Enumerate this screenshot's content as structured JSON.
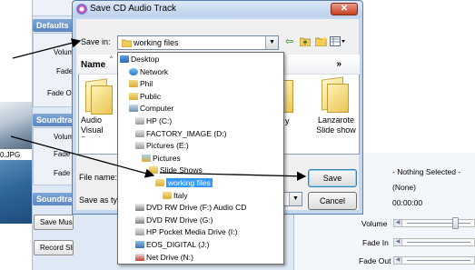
{
  "background": {
    "sections": [
      {
        "title": "Defaults",
        "labels": [
          "Volume",
          "Fade In",
          "Fade Out"
        ]
      },
      {
        "title": "Soundtrack",
        "labels": [
          "Volume",
          "Fade In",
          "Fade Out"
        ]
      },
      {
        "title": "Soundtrack"
      }
    ],
    "buttons": {
      "save_music": "Save Music From CD",
      "record_timings": "Record Slide Timings"
    },
    "photo_label": "0.JPG",
    "right_panel": {
      "nothing_selected": "- Nothing Selected -",
      "none": "(None)",
      "time": "00:00:00",
      "labels": [
        "Volume",
        "Fade In",
        "Fade Out"
      ]
    }
  },
  "dialog": {
    "title": "Save CD Audio Track",
    "save_in_label": "Save in:",
    "save_in_value": "working files",
    "name_column": "Name",
    "folders": [
      {
        "name": "Audio Visual Road Show"
      },
      {
        "name": "Lanzarote Slide show"
      }
    ],
    "folder_partial_text": "y",
    "file_name_label": "File name:",
    "save_as_type_label": "Save as type:",
    "save_button": "Save",
    "cancel_button": "Cancel"
  },
  "dropdown_items": [
    {
      "label": "Desktop",
      "icon": "desktop-icon",
      "selected": false
    },
    {
      "label": "Network",
      "icon": "network-icon",
      "selected": false
    },
    {
      "label": "Phil",
      "icon": "user-folder-icon",
      "selected": false
    },
    {
      "label": "Public",
      "icon": "folder-icon",
      "selected": false
    },
    {
      "label": "Computer",
      "icon": "computer-icon",
      "selected": false
    },
    {
      "label": "HP (C:)",
      "icon": "drive-icon",
      "selected": false
    },
    {
      "label": "FACTORY_IMAGE (D:)",
      "icon": "drive-icon",
      "selected": false
    },
    {
      "label": "Pictures (E:)",
      "icon": "drive-icon",
      "selected": false
    },
    {
      "label": "Pictures",
      "icon": "pictures-folder-icon",
      "selected": false
    },
    {
      "label": "Slide Shows",
      "icon": "folder-icon",
      "selected": false
    },
    {
      "label": "working files",
      "icon": "folder-icon",
      "selected": true
    },
    {
      "label": "Italy",
      "icon": "folder-icon",
      "selected": false
    },
    {
      "label": "DVD RW Drive (F:) Audio CD",
      "icon": "dvd-drive-icon",
      "selected": false
    },
    {
      "label": "DVD RW Drive (G:)",
      "icon": "dvd-drive-icon",
      "selected": false
    },
    {
      "label": "HP Pocket Media Drive (I:)",
      "icon": "drive-icon",
      "selected": false
    },
    {
      "label": "EOS_DIGITAL (J:)",
      "icon": "camera-card-icon",
      "selected": false
    },
    {
      "label": "Net Drive (N:)",
      "icon": "network-drive-icon",
      "selected": false
    }
  ],
  "colors": {
    "selection": "#3399ff",
    "title_bar": "#c4d8ef",
    "close_button": "#c5401f"
  }
}
